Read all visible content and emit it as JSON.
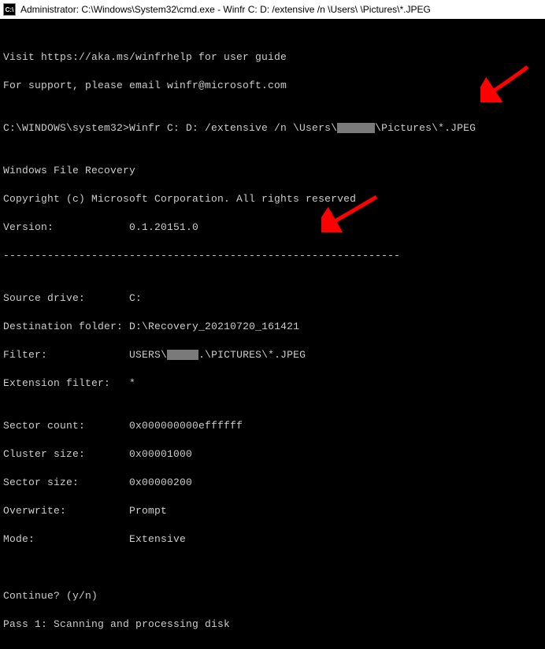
{
  "titlebar": {
    "icon_label": "C:\\",
    "title_prefix": "Administrator: C:\\Windows\\System32\\cmd.exe - Winfr  C: D: /extensive /n \\Users\\",
    "redacted": "      ",
    "title_suffix": "\\Pictures\\*.JPEG"
  },
  "term": {
    "blank": "",
    "help1": "Visit https://aka.ms/winfrhelp for user guide",
    "help2": "For support, please email winfr@microsoft.com",
    "prompt_prefix": "C:\\WINDOWS\\system32>Winfr C: D: /extensive /n \\Users\\",
    "prompt_redact": "      ",
    "prompt_suffix": "\\Pictures\\*.JPEG",
    "app_name": "Windows File Recovery",
    "copyright": "Copyright (c) Microsoft Corporation. All rights reserved",
    "version_label": "Version:",
    "version_value": "0.1.20151.0",
    "divider": "---------------------------------------------------------------",
    "src_label": "Source drive:",
    "src_value": "C:",
    "dst_label": "Destination folder:",
    "dst_value": "D:\\Recovery_20210720_161421",
    "filter_label": "Filter:",
    "filter_prefix": "USERS\\",
    "filter_redact": "     ",
    "filter_dot": ".",
    "filter_suffix": "\\PICTURES\\*.JPEG",
    "ext_label": "Extension filter:",
    "ext_value": "*",
    "sector_count_label": "Sector count:",
    "sector_count_value": "0x000000000effffff",
    "cluster_size_label": "Cluster size:",
    "cluster_size_value": "0x00001000",
    "sector_size_label": "Sector size:",
    "sector_size_value": "0x00000200",
    "overwrite_label": "Overwrite:",
    "overwrite_value": "Prompt",
    "mode_label": "Mode:",
    "mode_value": "Extensive",
    "continue": "Continue? (y/n)",
    "pass1": "Pass 1: Scanning and processing disk"
  },
  "annotations": {
    "arrow1": "red-arrow",
    "arrow2": "red-arrow"
  }
}
